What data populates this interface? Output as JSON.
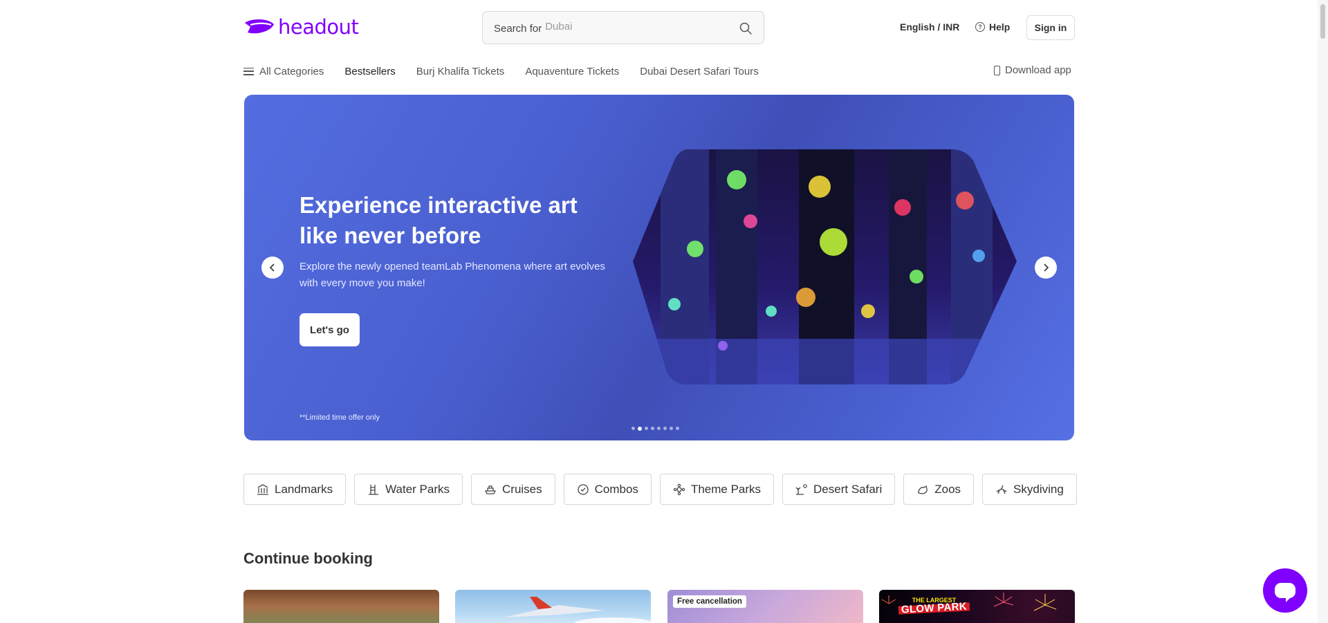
{
  "header": {
    "logo_text": "headout",
    "search_prefix": "Search for",
    "search_placeholder": "Dubai",
    "language_currency": "English / INR",
    "help_label": "Help",
    "signin_label": "Sign in"
  },
  "nav": {
    "all_categories": "All Categories",
    "links": [
      "Bestsellers",
      "Burj Khalifa Tickets",
      "Aquaventure Tickets",
      "Dubai Desert Safari Tours"
    ],
    "download_app": "Download app"
  },
  "hero": {
    "title": "Experience interactive art like never before",
    "description": "Explore the newly opened teamLab Phenomena where art evolves with every move you make!",
    "cta_label": "Let's go",
    "note": "**Limited time offer only",
    "slide_count": 8,
    "active_slide": 2
  },
  "categories": [
    {
      "label": "Landmarks",
      "icon": "landmark-icon"
    },
    {
      "label": "Water Parks",
      "icon": "water-park-icon"
    },
    {
      "label": "Cruises",
      "icon": "cruise-icon"
    },
    {
      "label": "Combos",
      "icon": "combo-icon"
    },
    {
      "label": "Theme Parks",
      "icon": "theme-park-icon"
    },
    {
      "label": "Desert Safari",
      "icon": "desert-safari-icon"
    },
    {
      "label": "Zoos",
      "icon": "zoo-icon"
    },
    {
      "label": "Skydiving",
      "icon": "skydiving-icon"
    }
  ],
  "continue_booking": {
    "title": "Continue booking",
    "cards": [
      {
        "badge": ""
      },
      {
        "badge": ""
      },
      {
        "badge": "Free cancellation"
      },
      {
        "badge": "",
        "image_text_top": "THE LARGEST",
        "image_text_main": "GLOW PARK"
      }
    ]
  },
  "colors": {
    "brand": "#8000ff",
    "hero_background": "#4a5fcf"
  }
}
